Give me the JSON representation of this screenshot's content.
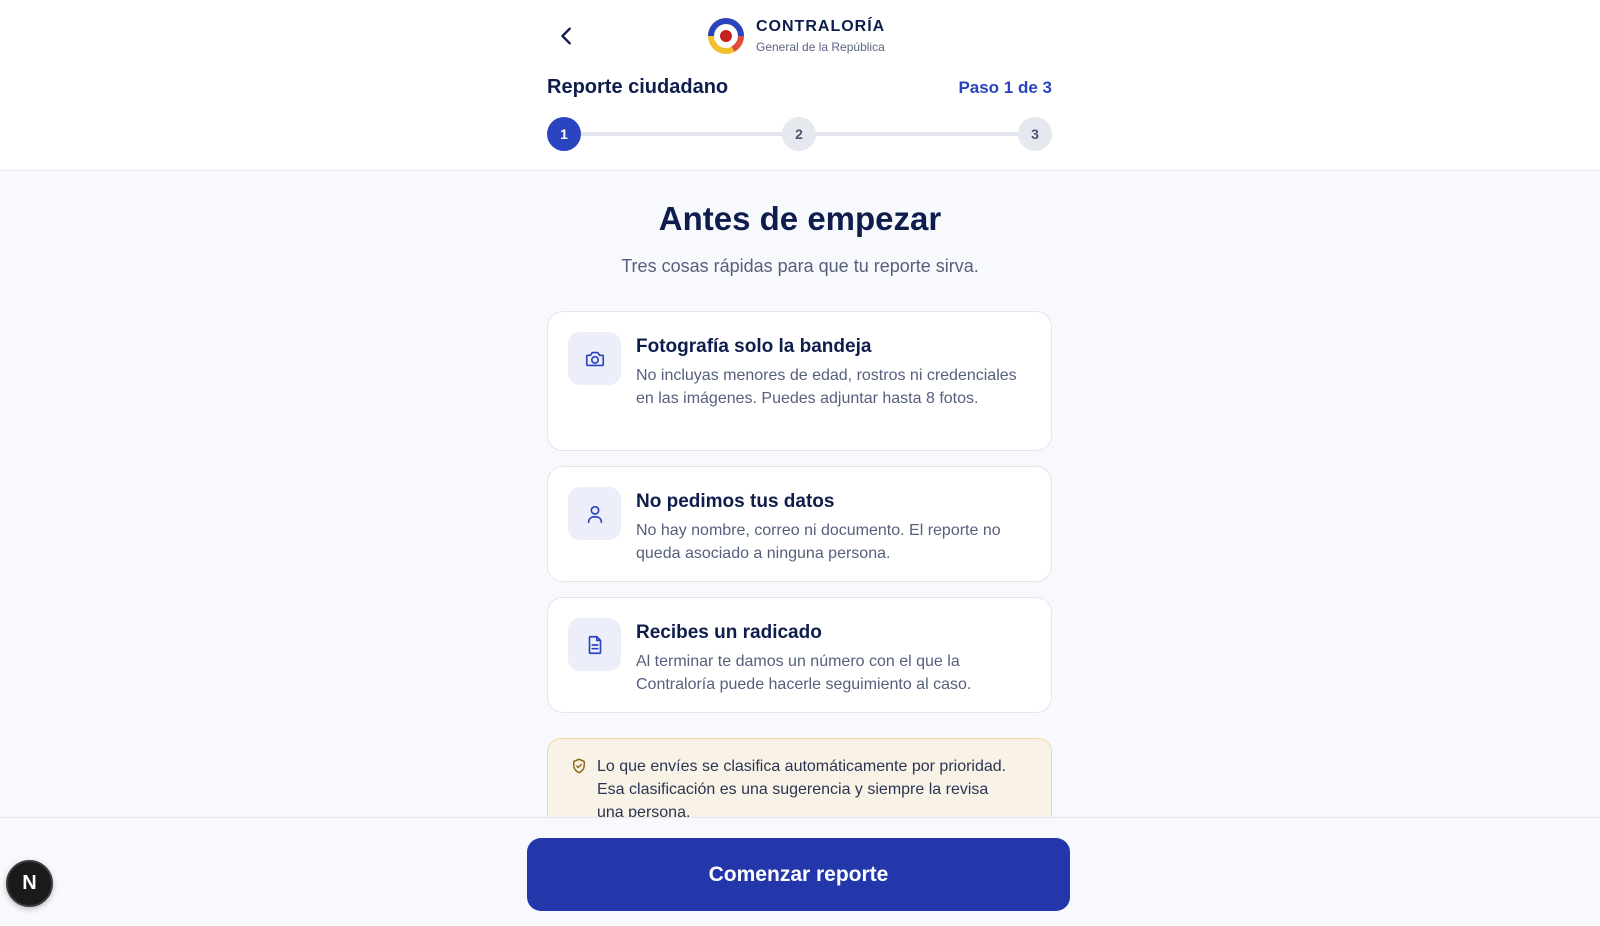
{
  "brand": {
    "title": "CONTRALORÍA",
    "subtitle": "General de la República",
    "logo_icon": "contraloria-logo"
  },
  "header": {
    "back_icon": "chevron-left-icon",
    "report_title": "Reporte ciudadano",
    "step_count": "Paso 1 de 3",
    "steps": [
      "1",
      "2",
      "3"
    ],
    "current_step": 1
  },
  "main": {
    "heading": "Antes de empezar",
    "subheading": "Tres cosas rápidas para que tu reporte sirva.",
    "cards": [
      {
        "icon": "camera-icon",
        "title": "Fotografía solo la bandeja",
        "description": "No incluyas menores de edad, rostros ni credenciales en las imágenes. Puedes adjuntar hasta 8 fotos."
      },
      {
        "icon": "user-icon",
        "title": "No pedimos tus datos",
        "description": "No hay nombre, correo ni documento. El reporte no queda asociado a ninguna persona."
      },
      {
        "icon": "document-icon",
        "title": "Recibes un radicado",
        "description": "Al terminar te damos un número con el que la Contraloría puede hacerle seguimiento al caso."
      }
    ],
    "notice": {
      "icon": "shield-check-icon",
      "text": "Lo que envíes se clasifica automáticamente por prioridad. Esa clasificación es una sugerencia y siempre la revisa una persona."
    }
  },
  "footer": {
    "cta_label": "Comenzar reporte"
  },
  "dev_badge": {
    "label": "N"
  },
  "colors": {
    "primary": "#2a44c0",
    "cta": "#2337ab",
    "heading": "#0f1d4d",
    "muted": "#56607d",
    "notice_bg": "#f9f3e7",
    "notice_border": "#f0d9a6"
  }
}
